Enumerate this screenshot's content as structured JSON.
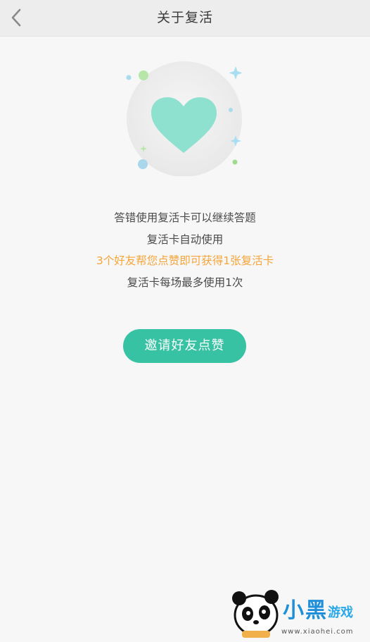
{
  "header": {
    "title": "关于复活",
    "back_icon": "chevron-left-icon"
  },
  "hero": {
    "icon": "heart-icon",
    "heart_color": "#8ee0cf",
    "circle_color": "#ececec"
  },
  "info": {
    "line1": "答错使用复活卡可以继续答题",
    "line2": "复活卡自动使用",
    "line3": "3个好友帮您点赞即可获得1张复活卡",
    "line4": "复活卡每场最多使用1次",
    "accent_color": "#f5a53a"
  },
  "cta": {
    "label": "邀请好友点赞",
    "color": "#36c2a3"
  },
  "watermark": {
    "brand": "小黑",
    "game": "游戏",
    "url": "www.xiaohei.com",
    "icon": "panda-logo-icon"
  }
}
